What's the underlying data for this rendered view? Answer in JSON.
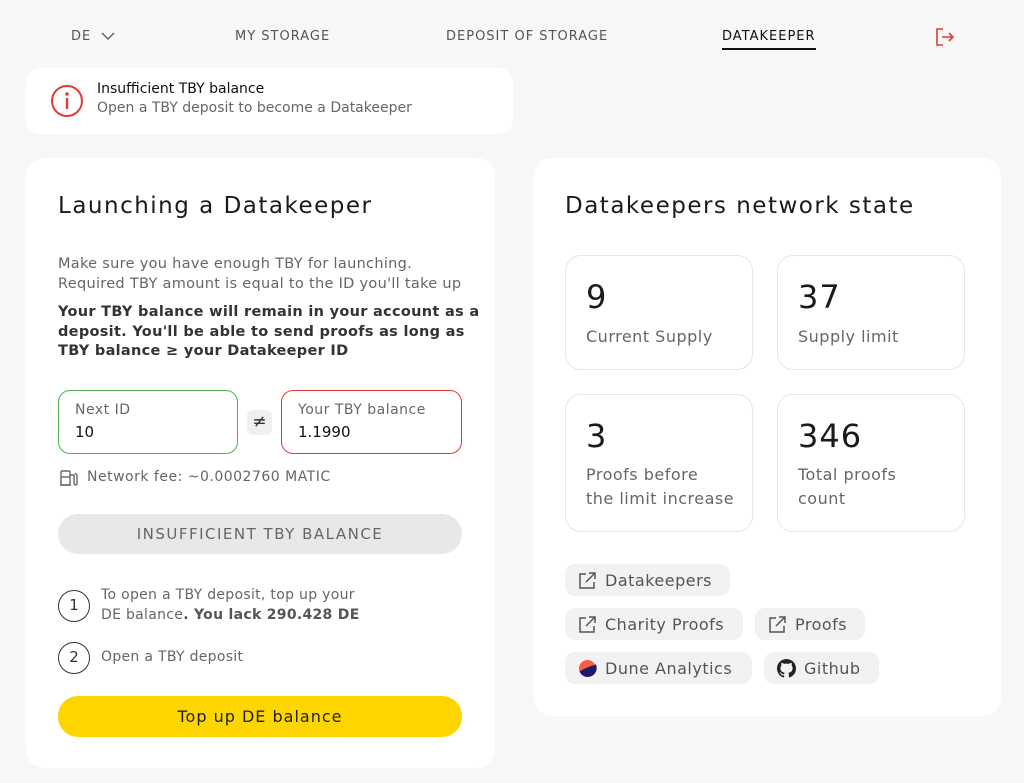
{
  "nav": {
    "lang": "DE",
    "links": [
      "MY STORAGE",
      "DEPOSIT OF STORAGE",
      "DATAKEEPER"
    ],
    "active": "DATAKEEPER"
  },
  "alert": {
    "title": "Insufficient TBY balance",
    "subtitle": "Open a TBY deposit to become a Datakeeper"
  },
  "launch": {
    "title": "Launching a Datakeeper",
    "desc_line1": "Make sure you have enough TBY for launching.",
    "desc_line2": "Required TBY amount is equal to the ID you'll take up",
    "bold_line1": "Your TBY balance will remain in your account as a",
    "bold_line2": "deposit. You'll be able to send proofs as long as",
    "bold_line3": "TBY balance ≥ your Datakeeper ID",
    "next_id_label": "Next ID",
    "next_id_value": "10",
    "neq_symbol": "≠",
    "balance_label": "Your TBY balance",
    "balance_value": "1.1990",
    "fee": "Network fee: ~0.0002760 MATIC",
    "disabled_button": "INSUFFICIENT TBY BALANCE",
    "step1_num": "1",
    "step1_line1": "To open a TBY deposit, top up your",
    "step1_line2a": "DE balance",
    "step1_line2b": ". You lack 290.428 DE",
    "step2_num": "2",
    "step2_text": "Open a TBY deposit",
    "topup_button": "Top up DE balance"
  },
  "network": {
    "title": "Datakeepers network state",
    "stats": [
      {
        "value": "9",
        "label1": "Current Supply",
        "label2": ""
      },
      {
        "value": "37",
        "label1": "Supply limit",
        "label2": ""
      },
      {
        "value": "3",
        "label1": "Proofs before",
        "label2": "the limit increase"
      },
      {
        "value": "346",
        "label1": "Total proofs",
        "label2": "count"
      }
    ],
    "links": [
      "Datakeepers",
      "Charity Proofs",
      "Proofs",
      "Dune Analytics",
      "Github"
    ]
  },
  "colors": {
    "accent_yellow": "#ffd500",
    "alert_red": "#e53935",
    "green_border": "#4caf50"
  }
}
